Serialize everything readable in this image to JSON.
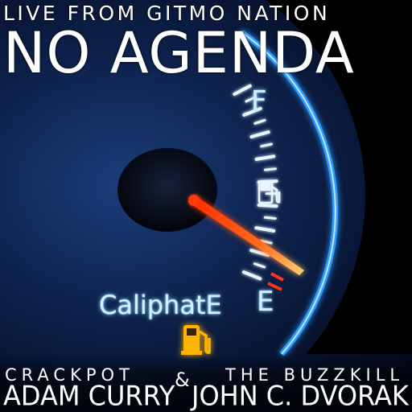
{
  "header": {
    "tagline": "LIVE FROM GITMO NATION",
    "title": "NO AGENDA"
  },
  "gauge": {
    "full_label": "F",
    "empty_label": "E",
    "caption": "CaliphatE",
    "accent_color": "#2f9bff",
    "needle_color": "#ff4a12",
    "warning_color": "#ffb400",
    "level": 0.08,
    "icons": [
      "fuel-pump-icon",
      "fuel-warning-icon"
    ]
  },
  "credits": {
    "left_role": "CRACKPOT",
    "left_name": "ADAM CURRY",
    "ampersand": "&",
    "right_role": "THE BUZZKILL",
    "right_name": "JOHN C. DVORAK"
  }
}
